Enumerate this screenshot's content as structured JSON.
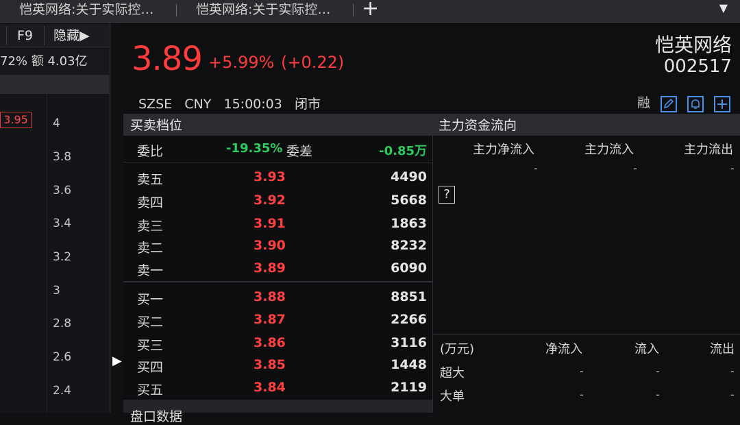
{
  "tabs": [
    {
      "label": "恺英网络:关于实际控…"
    },
    {
      "label": "恺英网络:关于实际控…"
    }
  ],
  "tabbar": {
    "add_symbol": "+",
    "menu_symbol": "▼"
  },
  "left_panel": {
    "f9_label": "F9",
    "hide_label": "隐藏▶",
    "info_text": "72%  额 4.03亿",
    "price_marker": "3.95",
    "y_ticks": [
      "4",
      "3.8",
      "3.6",
      "3.4",
      "3.2",
      "3",
      "2.8",
      "2.6",
      "2.4"
    ],
    "expand_symbol": "▶"
  },
  "quote": {
    "price": "3.89",
    "change_pct": "+5.99%",
    "change_abs": "(+0.22)",
    "stock_name": "恺英网络",
    "stock_code": "002517",
    "exchange": "SZSE",
    "currency": "CNY",
    "time": "15:00:03",
    "status": "闭市",
    "margin_label": "融",
    "accent_color": "#ff3b3b"
  },
  "order_book": {
    "title": "买卖档位",
    "weibi_label": "委比",
    "weibi_value": "-19.35%",
    "weicha_label": "委差",
    "weicha_value": "-0.85万",
    "asks": [
      {
        "label": "卖五",
        "price": "3.93",
        "volume": "4490"
      },
      {
        "label": "卖四",
        "price": "3.92",
        "volume": "5668"
      },
      {
        "label": "卖三",
        "price": "3.91",
        "volume": "1863"
      },
      {
        "label": "卖二",
        "price": "3.90",
        "volume": "8232"
      },
      {
        "label": "卖一",
        "price": "3.89",
        "volume": "6090"
      }
    ],
    "bids": [
      {
        "label": "买一",
        "price": "3.88",
        "volume": "8851"
      },
      {
        "label": "买二",
        "price": "3.87",
        "volume": "2266"
      },
      {
        "label": "买三",
        "price": "3.86",
        "volume": "3116"
      },
      {
        "label": "买四",
        "price": "3.85",
        "volume": "1448"
      },
      {
        "label": "买五",
        "price": "3.84",
        "volume": "2119"
      }
    ],
    "footer_title": "盘口数据"
  },
  "funds_flow": {
    "title": "主力资金流向",
    "headers": [
      "主力净流入",
      "主力流入",
      "主力流出"
    ],
    "values": [
      "-",
      "-",
      "-"
    ],
    "help_symbol": "?",
    "table_unit": "(万元)",
    "table_headers": [
      "净流入",
      "流入",
      "流出"
    ],
    "rows": [
      {
        "label": "超大",
        "values": [
          "-",
          "-",
          "-"
        ]
      },
      {
        "label": "大单",
        "values": [
          "-",
          "-",
          "-"
        ]
      }
    ]
  }
}
